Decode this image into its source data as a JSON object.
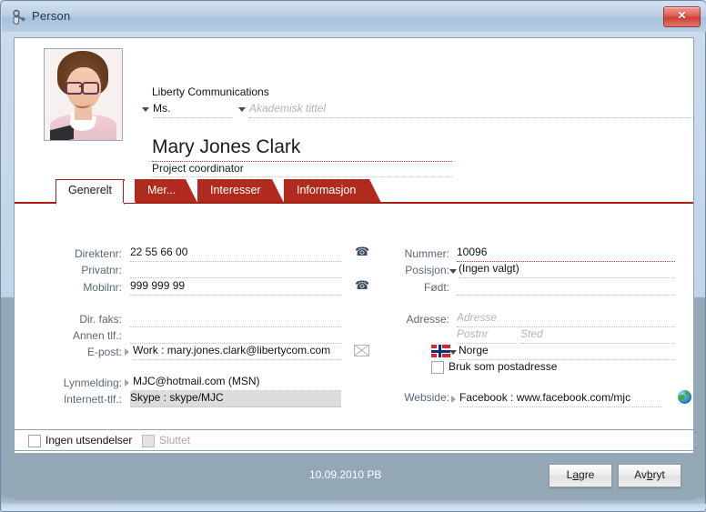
{
  "window": {
    "title": "Person",
    "icon": "person-key-icon",
    "close_label": "✕"
  },
  "header": {
    "photo_alt": "contact-photo",
    "company": "Liberty Communications",
    "salutation": "Ms.",
    "academic_title_placeholder": "Akademisk tittel",
    "name": "Mary Jones Clark",
    "role": "Project coordinator"
  },
  "tabs": [
    {
      "label": "Generelt",
      "active": true
    },
    {
      "label": "Mer...",
      "active": false
    },
    {
      "label": "Interesser",
      "active": false
    },
    {
      "label": "Informasjon",
      "active": false
    }
  ],
  "form": {
    "left": [
      {
        "label": "Direktenr:",
        "value": "22 55 66 00",
        "icon": "phone-icon"
      },
      {
        "label": "Privatnr:",
        "value": "",
        "icon": ""
      },
      {
        "label": "Mobilnr:",
        "value": "999 999 99",
        "icon": "phone-icon"
      },
      {
        "label": "Dir. faks:",
        "value": "",
        "icon": ""
      },
      {
        "label": "Annen tlf.:",
        "value": "",
        "icon": ""
      },
      {
        "label": "E-post:",
        "value": "Work : mary.jones.clark@libertycom.com",
        "icon": "envelope-icon"
      },
      {
        "label": "Lynmelding:",
        "value": "MJC@hotmail.com (MSN)",
        "icon": ""
      },
      {
        "label": "Internett-tlf.:",
        "value": "Skype : skype/MJC",
        "icon": ""
      }
    ],
    "right": {
      "nummer_label": "Nummer:",
      "nummer_value": "10096",
      "posisjon_label": "Posisjon:",
      "posisjon_value": "(Ingen valgt)",
      "fodt_label": "Født:",
      "fodt_value": "",
      "adresse_label": "Adresse:",
      "adresse_placeholder": "Adresse",
      "postnr_placeholder": "Postnr",
      "sted_placeholder": "Sted",
      "country": "Norge",
      "country_flag": "norway-flag-icon",
      "postaddress_checkbox_label": "Bruk som postadresse",
      "postaddress_checked": false,
      "webside_label": "Webside:",
      "webside_value": "Facebook : www.facebook.com/mjc",
      "webside_icon": "globe-icon"
    }
  },
  "bottom": {
    "no_mailings_label": "Ingen utsendelser",
    "no_mailings_checked": false,
    "ended_label": "Sluttet",
    "ended_checked": false,
    "ended_disabled": true
  },
  "footer": {
    "date": "10.09.2010 PB",
    "save_label_pre": "L",
    "save_label_accel": "a",
    "save_label_post": "gre",
    "cancel_label_pre": "Av",
    "cancel_label_accel": "b",
    "cancel_label_post": "ryt"
  },
  "colors": {
    "tab_red": "#b02b1d",
    "tab_underline": "#a71f13",
    "titlebar": "#b9cee4",
    "footer_bg": "#93a7b4",
    "label_text": "#5a6876",
    "close_red": "#cf4036"
  }
}
